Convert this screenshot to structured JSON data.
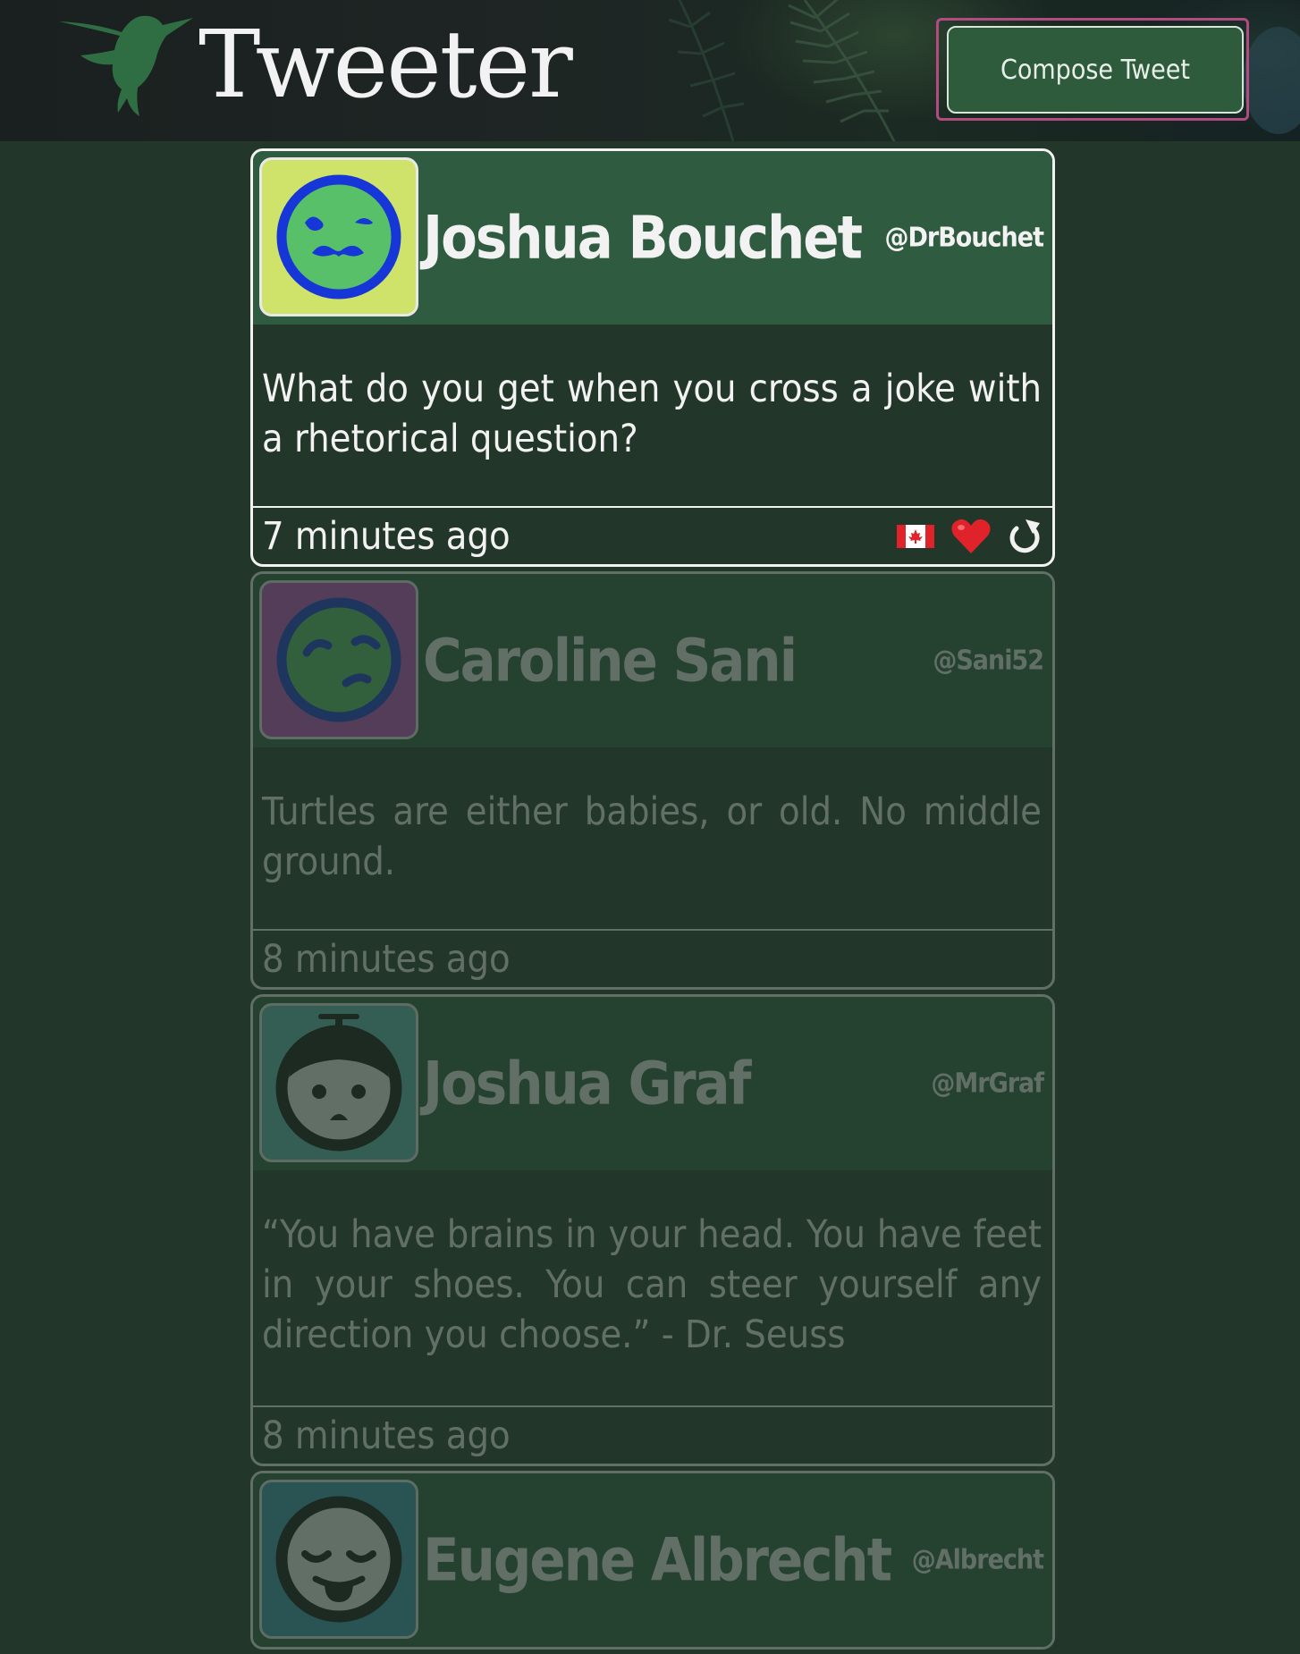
{
  "header": {
    "brand": "Tweeter",
    "logo_icon": "hummingbird-icon",
    "compose_label": "Compose Tweet"
  },
  "tweets": [
    {
      "name": "Joshua Bouchet",
      "handle": "@DrBouchet",
      "text": "What do you get when you cross a joke with a rhetorical question?",
      "time": "7 minutes ago",
      "avatar_bg": "#cfe36a",
      "avatar_icon": "mustache-face-icon",
      "actions": [
        "flag-icon",
        "heart-icon",
        "retweet-icon"
      ],
      "active": true
    },
    {
      "name": "Caroline Sani",
      "handle": "@Sani52",
      "text": "Turtles are either babies, or old. No middle ground.",
      "time": "8 minutes ago",
      "avatar_bg": "#c44fc9",
      "avatar_icon": "smirk-face-icon",
      "active": false
    },
    {
      "name": "Joshua Graf",
      "handle": "@MrGraf",
      "text": "“You have brains in your head. You have feet in your shoes. You can steer yourself any direction you choose.” - Dr. Seuss",
      "time": "8 minutes ago",
      "avatar_bg": "#5fb9b4",
      "avatar_icon": "propeller-cap-face-icon",
      "active": false
    },
    {
      "name": "Eugene Albrecht",
      "handle": "@Albrecht",
      "time": "",
      "avatar_bg": "#3e98b9",
      "avatar_icon": "tongue-face-icon",
      "active": false
    }
  ],
  "colors": {
    "page_bg": "#223629",
    "card_head": "#2f5b40",
    "compose_border": "#b34a82",
    "heart": "#e0222a"
  }
}
